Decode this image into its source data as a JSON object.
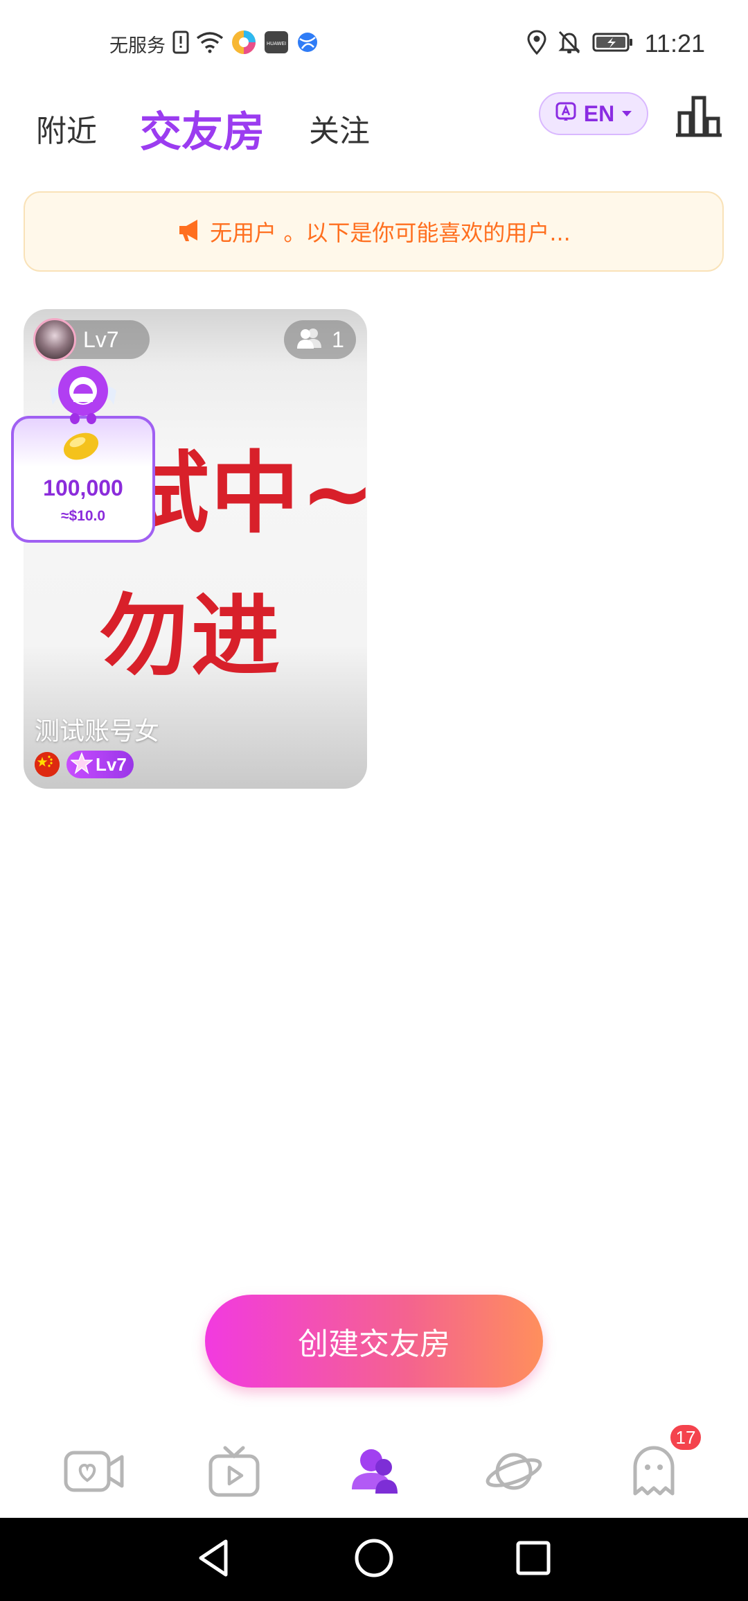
{
  "status_bar": {
    "carrier": "无服务",
    "time": "11:21",
    "icons": [
      "sim-alert-icon",
      "wifi-icon",
      "app-icon",
      "huawei-icon",
      "browser-icon",
      "location-icon",
      "mute-icon",
      "battery-icon"
    ]
  },
  "header": {
    "tabs": [
      {
        "label": "附近",
        "active": false
      },
      {
        "label": "交友房",
        "active": true
      },
      {
        "label": "关注",
        "active": false
      }
    ],
    "language_button": "EN",
    "accent_color": "#9b3cf0"
  },
  "notice": {
    "text": "无用户 。以下是你可能喜欢的用户..."
  },
  "room_card": {
    "owner_level": "Lv7",
    "member_count": "1",
    "cover_line1": "试中~",
    "cover_line2": "勿进",
    "name": "测试账号女",
    "user_level": "Lv7"
  },
  "reward": {
    "amount": "100,000",
    "usd": "≈$10.0"
  },
  "create_button": "创建交友房",
  "bottom_nav": {
    "items": [
      {
        "icon": "video-call-icon",
        "active": false
      },
      {
        "icon": "live-tv-icon",
        "active": false
      },
      {
        "icon": "party-room-icon",
        "active": true
      },
      {
        "icon": "planet-icon",
        "active": false
      },
      {
        "icon": "messages-ghost-icon",
        "active": false
      }
    ],
    "message_badge": "17"
  },
  "system_nav": [
    "back-icon",
    "home-icon",
    "recents-icon"
  ]
}
